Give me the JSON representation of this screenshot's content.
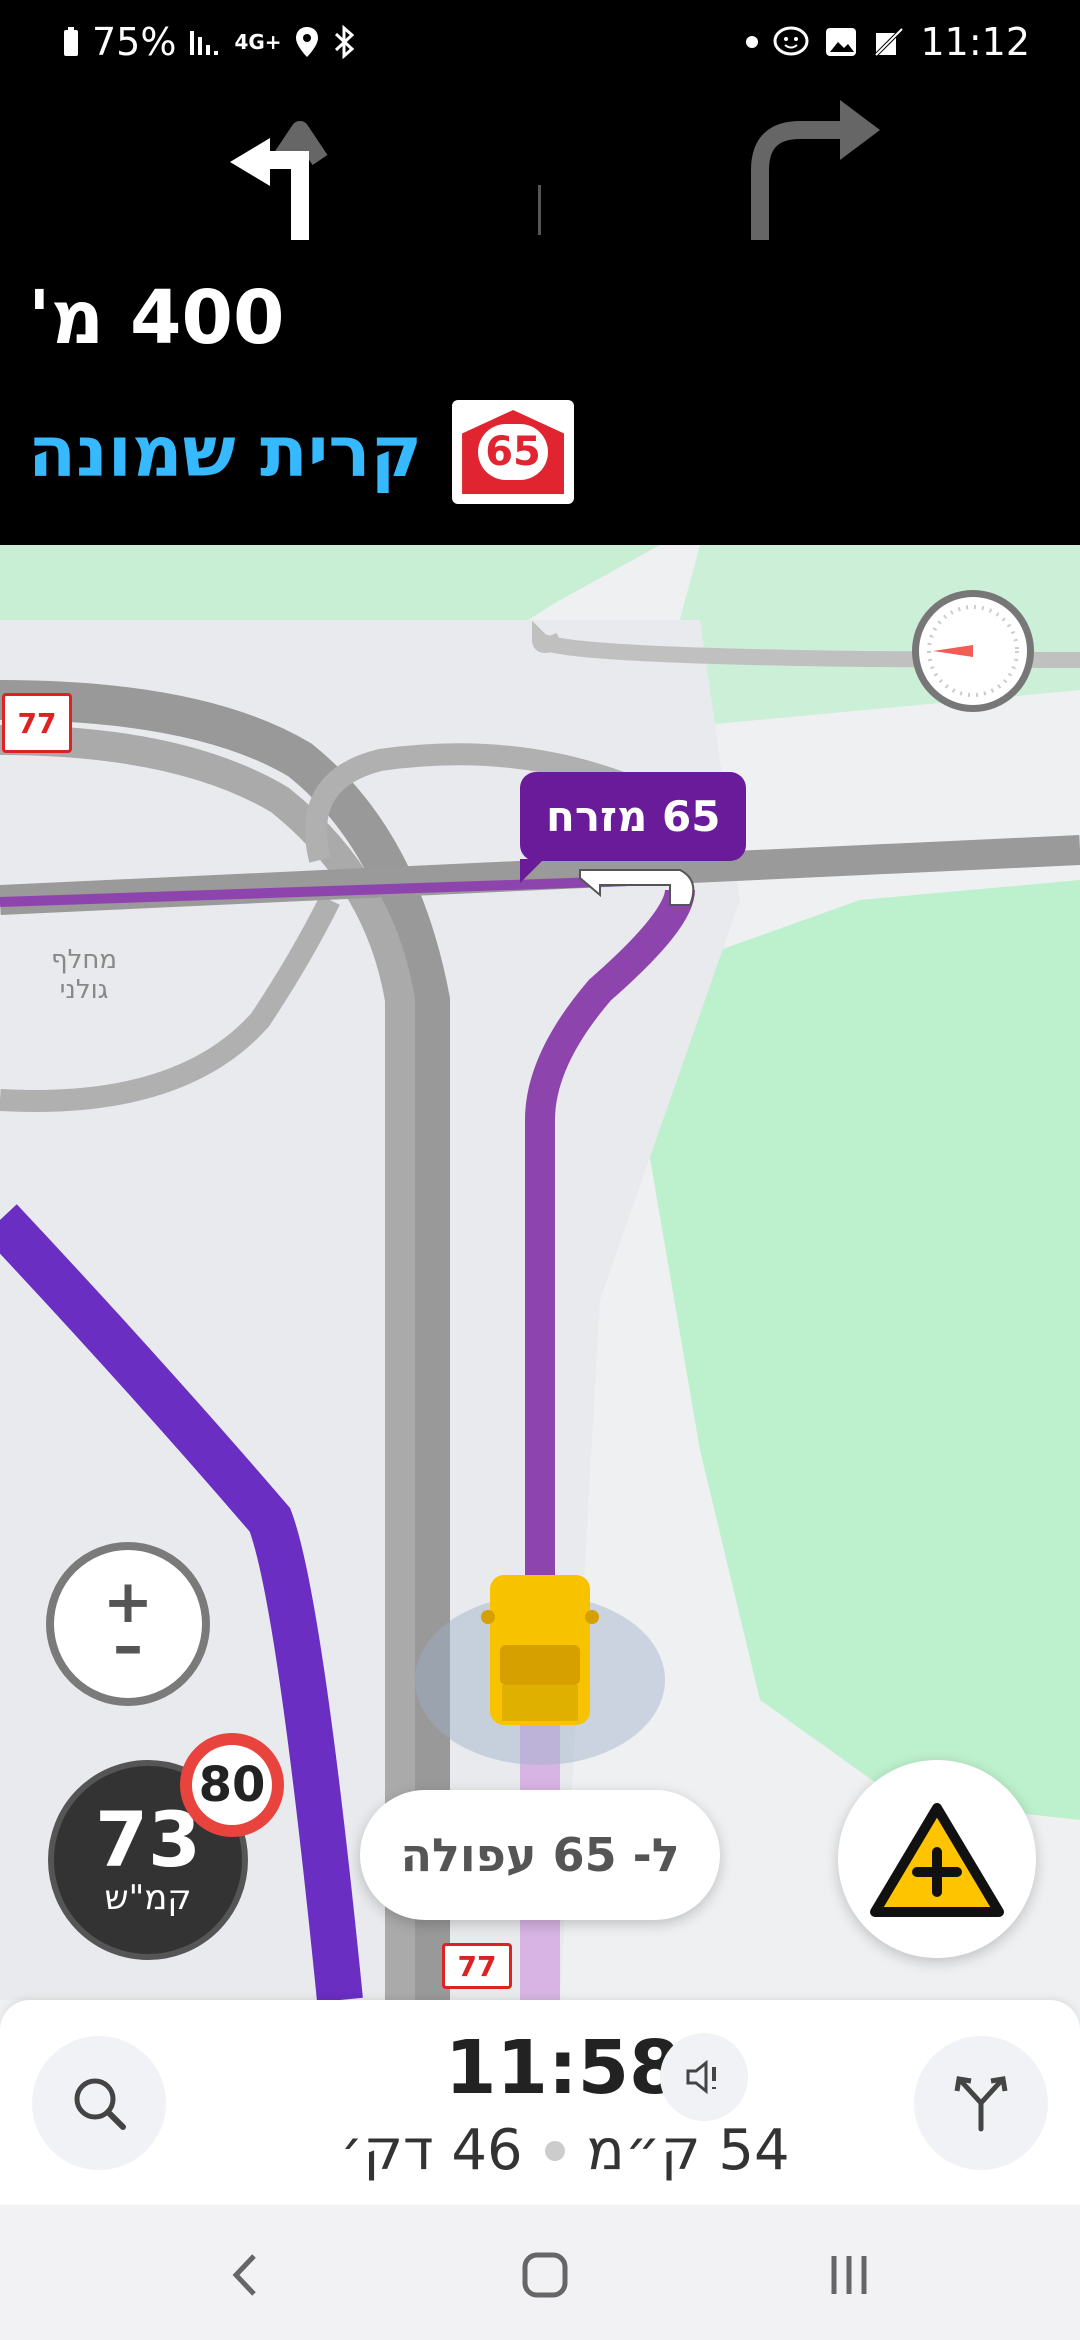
{
  "status_bar": {
    "battery": "75%",
    "network": "4G+",
    "time": "11:12",
    "icons": [
      "battery-icon",
      "signal-icon",
      "network-icon",
      "location-icon",
      "bluetooth-icon",
      "dot-icon",
      "waze-icon",
      "gallery-icon",
      "mute-icon"
    ]
  },
  "instruction": {
    "distance": "400 מ'",
    "street": "קרית שמונה",
    "route_number": "65"
  },
  "map": {
    "bubble_label": "65 מזרח",
    "place_label_line1": "מחלף",
    "place_label_line2": "גולני",
    "road_shield_77": "77",
    "road_shield_77_bottom": "77",
    "route_color": "#7b2fc2"
  },
  "controls": {
    "current_speed": "73",
    "speed_unit": "קמ\"ש",
    "speed_limit": "80",
    "next_instruction_pill": "ל- 65 עפולה"
  },
  "trip": {
    "eta": "11:58",
    "distance": "54 ק״מ",
    "duration": "46 דק׳"
  },
  "colors": {
    "accent_blue": "#36b9ff",
    "purple": "#6a1b9a",
    "report_yellow": "#ffc400",
    "speed_limit_red": "#e8443d"
  }
}
